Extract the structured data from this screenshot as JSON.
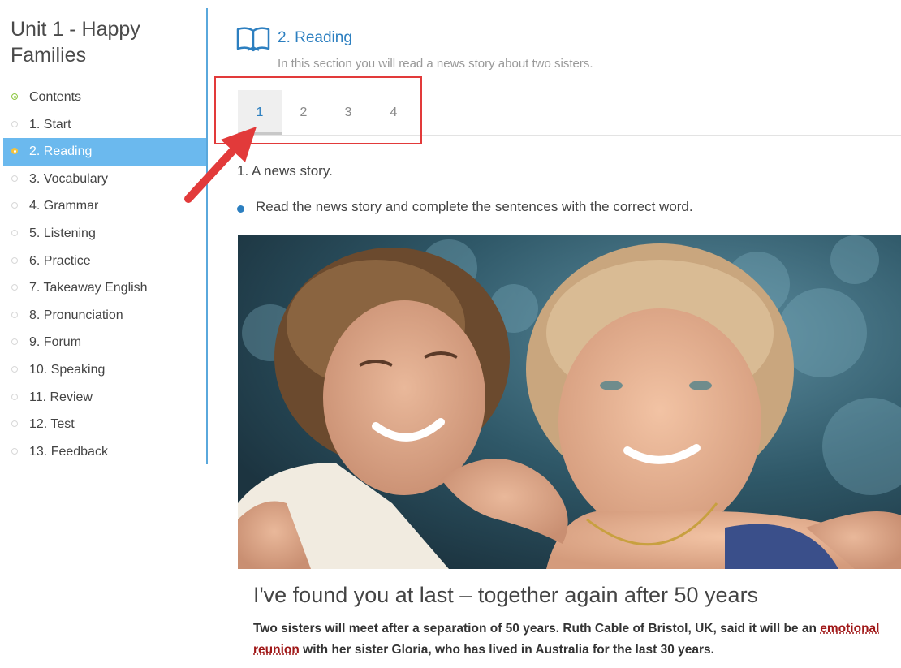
{
  "sidebar": {
    "unit_title": "Unit 1 - Happy Families",
    "items": [
      {
        "label": "Contents"
      },
      {
        "label": "1. Start"
      },
      {
        "label": "2. Reading"
      },
      {
        "label": "3. Vocabulary"
      },
      {
        "label": "4. Grammar"
      },
      {
        "label": "5. Listening"
      },
      {
        "label": "6. Practice"
      },
      {
        "label": "7. Takeaway English"
      },
      {
        "label": "8. Pronunciation"
      },
      {
        "label": "9. Forum"
      },
      {
        "label": "10. Speaking"
      },
      {
        "label": "11. Review"
      },
      {
        "label": "12. Test"
      },
      {
        "label": "13. Feedback"
      }
    ],
    "active_index": 2
  },
  "section": {
    "icon": "book-icon",
    "title": "2. Reading",
    "subtitle": "In this section you will read a news story about two sisters."
  },
  "tabs": [
    "1",
    "2",
    "3",
    "4"
  ],
  "active_tab": "1",
  "task": {
    "heading": "1. A news story.",
    "instruction": "Read the news story and complete the sentences with the correct word."
  },
  "article": {
    "title": "I've found you at last – together again after 50 years",
    "body_pre": "Two sisters will meet after a separation of 50 years. Ruth Cable of Bristol, UK, said it will be an",
    "body_link": "emotional reunion",
    "body_post": "with her sister Gloria, who has lived in Australia for the last 30 years."
  },
  "colors": {
    "accent": "#2c7fc0",
    "active_nav": "#6bb9ee",
    "annotation_red": "#e23a3a"
  }
}
